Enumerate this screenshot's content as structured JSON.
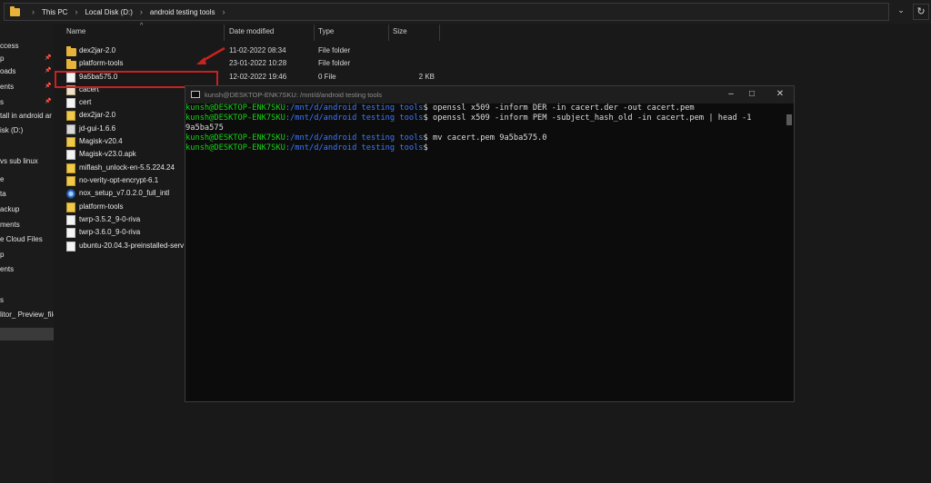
{
  "address_bar": {
    "crumbs": [
      "This PC",
      "Local Disk (D:)",
      "android testing tools"
    ],
    "chevron_icon": "chevron-down-icon",
    "refresh_icon": "refresh-icon"
  },
  "nav_pane": {
    "items": [
      {
        "label": "ccess",
        "pinned": false
      },
      {
        "label": "p",
        "pinned": true
      },
      {
        "label": "oads",
        "pinned": true
      },
      {
        "label": "ents",
        "pinned": true
      },
      {
        "label": "s",
        "pinned": true
      },
      {
        "label": "tall in android ar",
        "pinned": false
      },
      {
        "label": "isk (D:)",
        "pinned": false
      },
      {
        "label": "vs sub linux",
        "pinned": false
      },
      {
        "label": "e",
        "pinned": false
      },
      {
        "label": "ta",
        "pinned": false
      },
      {
        "label": "ackup",
        "pinned": false
      },
      {
        "label": "ments",
        "pinned": false
      },
      {
        "label": "e Cloud Files",
        "pinned": false
      },
      {
        "label": "p",
        "pinned": false
      },
      {
        "label": "ents",
        "pinned": false
      },
      {
        "label": "s",
        "pinned": false
      },
      {
        "label": "litor_ Preview_file",
        "pinned": false
      },
      {
        "label": "",
        "pinned": false,
        "selected": true
      }
    ]
  },
  "columns": {
    "name": "Name",
    "date": "Date modified",
    "type": "Type",
    "size": "Size"
  },
  "files": [
    {
      "name": "dex2jar-2.0",
      "date": "11-02-2022 08:34",
      "type": "File folder",
      "size": "",
      "icon": "folder"
    },
    {
      "name": "platform-tools",
      "date": "23-01-2022 10:28",
      "type": "File folder",
      "size": "",
      "icon": "folder"
    },
    {
      "name": "9a5ba575.0",
      "date": "12-02-2022 19:46",
      "type": "0 File",
      "size": "2 KB",
      "icon": "file"
    },
    {
      "name": "cacert",
      "date": "",
      "type": "",
      "size": "",
      "icon": "cert"
    },
    {
      "name": "cert",
      "date": "",
      "type": "",
      "size": "",
      "icon": "file"
    },
    {
      "name": "dex2jar-2.0",
      "date": "",
      "type": "",
      "size": "",
      "icon": "yellow"
    },
    {
      "name": "jd-gui-1.6.6",
      "date": "",
      "type": "",
      "size": "",
      "icon": "jar"
    },
    {
      "name": "Magisk-v20.4",
      "date": "",
      "type": "",
      "size": "",
      "icon": "yellow"
    },
    {
      "name": "Magisk-v23.0.apk",
      "date": "",
      "type": "",
      "size": "",
      "icon": "file"
    },
    {
      "name": "miflash_unlock-en-5.5.224.24",
      "date": "",
      "type": "",
      "size": "",
      "icon": "yellow"
    },
    {
      "name": "no-verity-opt-encrypt-6.1",
      "date": "",
      "type": "",
      "size": "",
      "icon": "yellow"
    },
    {
      "name": "nox_setup_v7.0.2.0_full_intl",
      "date": "",
      "type": "",
      "size": "",
      "icon": "disc"
    },
    {
      "name": "platform-tools",
      "date": "",
      "type": "",
      "size": "",
      "icon": "yellow"
    },
    {
      "name": "twrp-3.5.2_9-0-riva",
      "date": "",
      "type": "",
      "size": "",
      "icon": "file"
    },
    {
      "name": "twrp-3.6.0_9-0-riva",
      "date": "",
      "type": "",
      "size": "",
      "icon": "file"
    },
    {
      "name": "ubuntu-20.04.3-preinstalled-serv",
      "date": "",
      "type": "",
      "size": "",
      "icon": "file"
    }
  ],
  "terminal": {
    "title": "kunsh@DESKTOP-ENK7SKU: /mnt/d/android testing tools",
    "window_buttons": [
      "–",
      "□",
      "✕"
    ],
    "lines": [
      {
        "user": "kunsh@DESKTOP-ENK7SKU",
        "path": ":/mnt/d/android testing tools",
        "cmd": "$ openssl x509 -inform DER -in cacert.der -out cacert.pem"
      },
      {
        "user": "kunsh@DESKTOP-ENK7SKU",
        "path": ":/mnt/d/android testing tools",
        "cmd": "$ openssl x509 -inform PEM -subject_hash_old -in cacert.pem | head -1"
      },
      {
        "output": "9a5ba575"
      },
      {
        "user": "kunsh@DESKTOP-ENK7SKU",
        "path": ":/mnt/d/android testing tools",
        "cmd": "$ mv cacert.pem 9a5ba575.0"
      },
      {
        "user": "kunsh@DESKTOP-ENK7SKU",
        "path": ":/mnt/d/android testing tools",
        "cmd": "$"
      }
    ]
  },
  "colors": {
    "highlight": "#c82121",
    "prompt_user": "#13d213",
    "prompt_path": "#3b78ff"
  }
}
